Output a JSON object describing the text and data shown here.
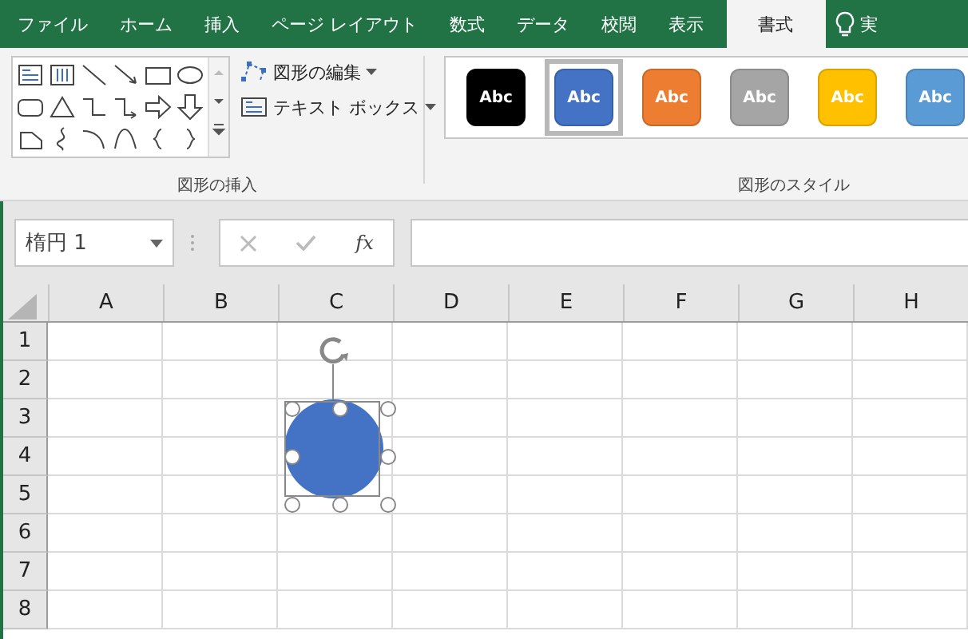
{
  "ribbon_tabs": [
    {
      "label": "ファイル",
      "selected": false
    },
    {
      "label": "ホーム",
      "selected": false
    },
    {
      "label": "挿入",
      "selected": false
    },
    {
      "label": "ページ レイアウト",
      "selected": false
    },
    {
      "label": "数式",
      "selected": false
    },
    {
      "label": "データ",
      "selected": false
    },
    {
      "label": "校閲",
      "selected": false
    },
    {
      "label": "表示",
      "selected": false
    },
    {
      "label": "書式",
      "selected": true
    },
    {
      "label": "実",
      "selected": false,
      "kind": "tell-me"
    }
  ],
  "ribbon": {
    "insert_shapes": {
      "edit_shape": "図形の編集",
      "text_box": "テキスト ボックス",
      "group_label": "図形の挿入"
    },
    "shape_styles": {
      "styles": [
        {
          "label": "Abc",
          "color": "#000000",
          "selected": false
        },
        {
          "label": "Abc",
          "color": "#4472c4",
          "selected": true
        },
        {
          "label": "Abc",
          "color": "#ed7d31",
          "selected": false
        },
        {
          "label": "Abc",
          "color": "#a5a5a5",
          "selected": false
        },
        {
          "label": "Abc",
          "color": "#ffc000",
          "selected": false
        },
        {
          "label": "Abc",
          "color": "#5b9bd5",
          "selected": false
        }
      ],
      "group_label": "図形のスタイル"
    }
  },
  "formula_bar": {
    "name_box": "楕円 1",
    "function_button": "fx"
  },
  "sheet": {
    "columns": [
      "A",
      "B",
      "C",
      "D",
      "E",
      "F",
      "G",
      "H"
    ],
    "rows": [
      "1",
      "2",
      "3",
      "4",
      "5",
      "6",
      "7",
      "8"
    ],
    "shape": {
      "kind": "ellipse",
      "color": "#4472c4",
      "selected": true
    }
  }
}
